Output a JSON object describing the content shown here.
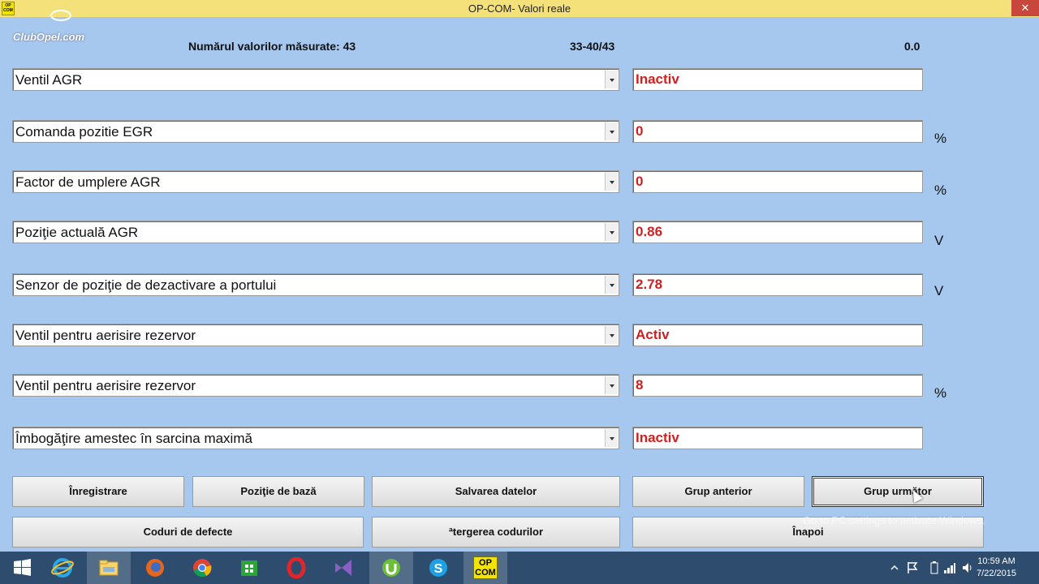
{
  "window": {
    "title": "OP-COM- Valori reale",
    "icon_text": "OP COM",
    "close_glyph": "✕"
  },
  "logo": {
    "text": "ClubOpel.com"
  },
  "header": {
    "count_label": "Numărul valorilor măsurate: 43",
    "range": "33-40/43",
    "time": "0.0"
  },
  "rows": [
    {
      "param": "Ventil AGR",
      "value": "Inactiv",
      "unit": ""
    },
    {
      "param": "Comanda pozitie EGR",
      "value": "0",
      "unit": "%"
    },
    {
      "param": "Factor de umplere AGR",
      "value": "0",
      "unit": "%"
    },
    {
      "param": "Poziţie actuală AGR",
      "value": "0.86",
      "unit": "V"
    },
    {
      "param": "Senzor de poziţie de dezactivare a portului",
      "value": "2.78",
      "unit": "V"
    },
    {
      "param": "Ventil pentru aerisire rezervor",
      "value": "Activ",
      "unit": ""
    },
    {
      "param": "Ventil pentru aerisire rezervor",
      "value": "8",
      "unit": "%"
    },
    {
      "param": "Îmbogăţire amestec în sarcina maximă",
      "value": "Inactiv",
      "unit": ""
    }
  ],
  "buttons": {
    "record": "Înregistrare",
    "base_position": "Poziţie de bază",
    "save_data": "Salvarea datelor",
    "prev_group": "Grup anterior",
    "next_group": "Grup următor",
    "fault_codes": "Coduri de defecte",
    "clear_codes": "ªtergerea codurilor",
    "back": "Înapoi"
  },
  "watermark": "Go to PC settings to activate Windows.",
  "taskbar": {
    "apps": [
      "windows-start",
      "internet-explorer",
      "file-explorer",
      "firefox",
      "chrome",
      "windows-store",
      "opera",
      "visual-studio",
      "utorrent",
      "skype",
      "op-com"
    ],
    "opcom_label": "OP COM",
    "time": "10:59 AM",
    "date": "7/22/2015"
  },
  "colors": {
    "background": "#a6c8ee",
    "value_text": "#d21f1f",
    "title_bar": "#f5e17a",
    "taskbar": "#2e4d6e"
  }
}
